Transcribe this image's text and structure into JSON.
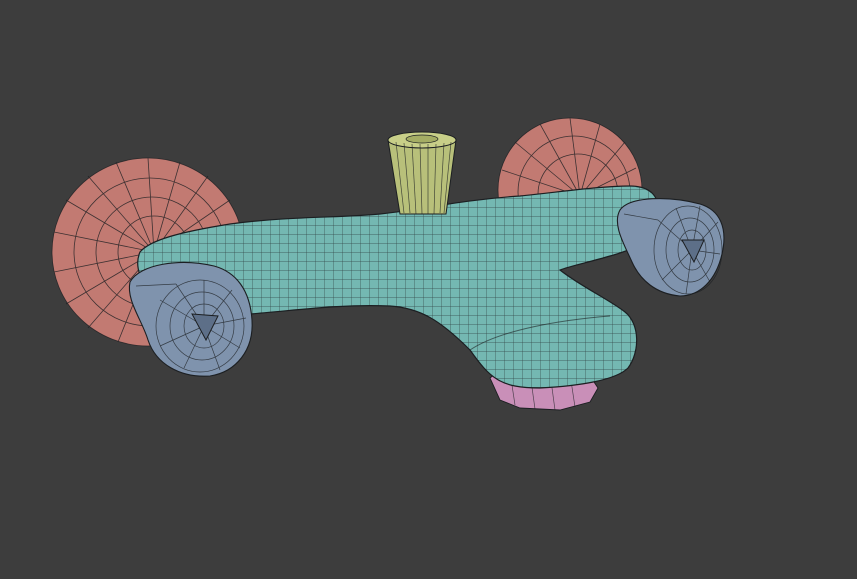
{
  "viewport": {
    "background": "#3d3d3d"
  },
  "model": {
    "subject": "bath-mixer-faucet-wireframe",
    "parts": [
      {
        "name": "left-wall-flange",
        "color": "#c27a72"
      },
      {
        "name": "right-wall-flange",
        "color": "#c27a72"
      },
      {
        "name": "faucet-body",
        "color": "#74b8b2"
      },
      {
        "name": "left-handle",
        "color": "#7f93ad"
      },
      {
        "name": "right-handle",
        "color": "#7f93ad"
      },
      {
        "name": "diverter-knob",
        "color": "#b8c07a"
      },
      {
        "name": "spout-aerator",
        "color": "#c98fb8"
      }
    ],
    "wire_color": "#1c1f22"
  }
}
